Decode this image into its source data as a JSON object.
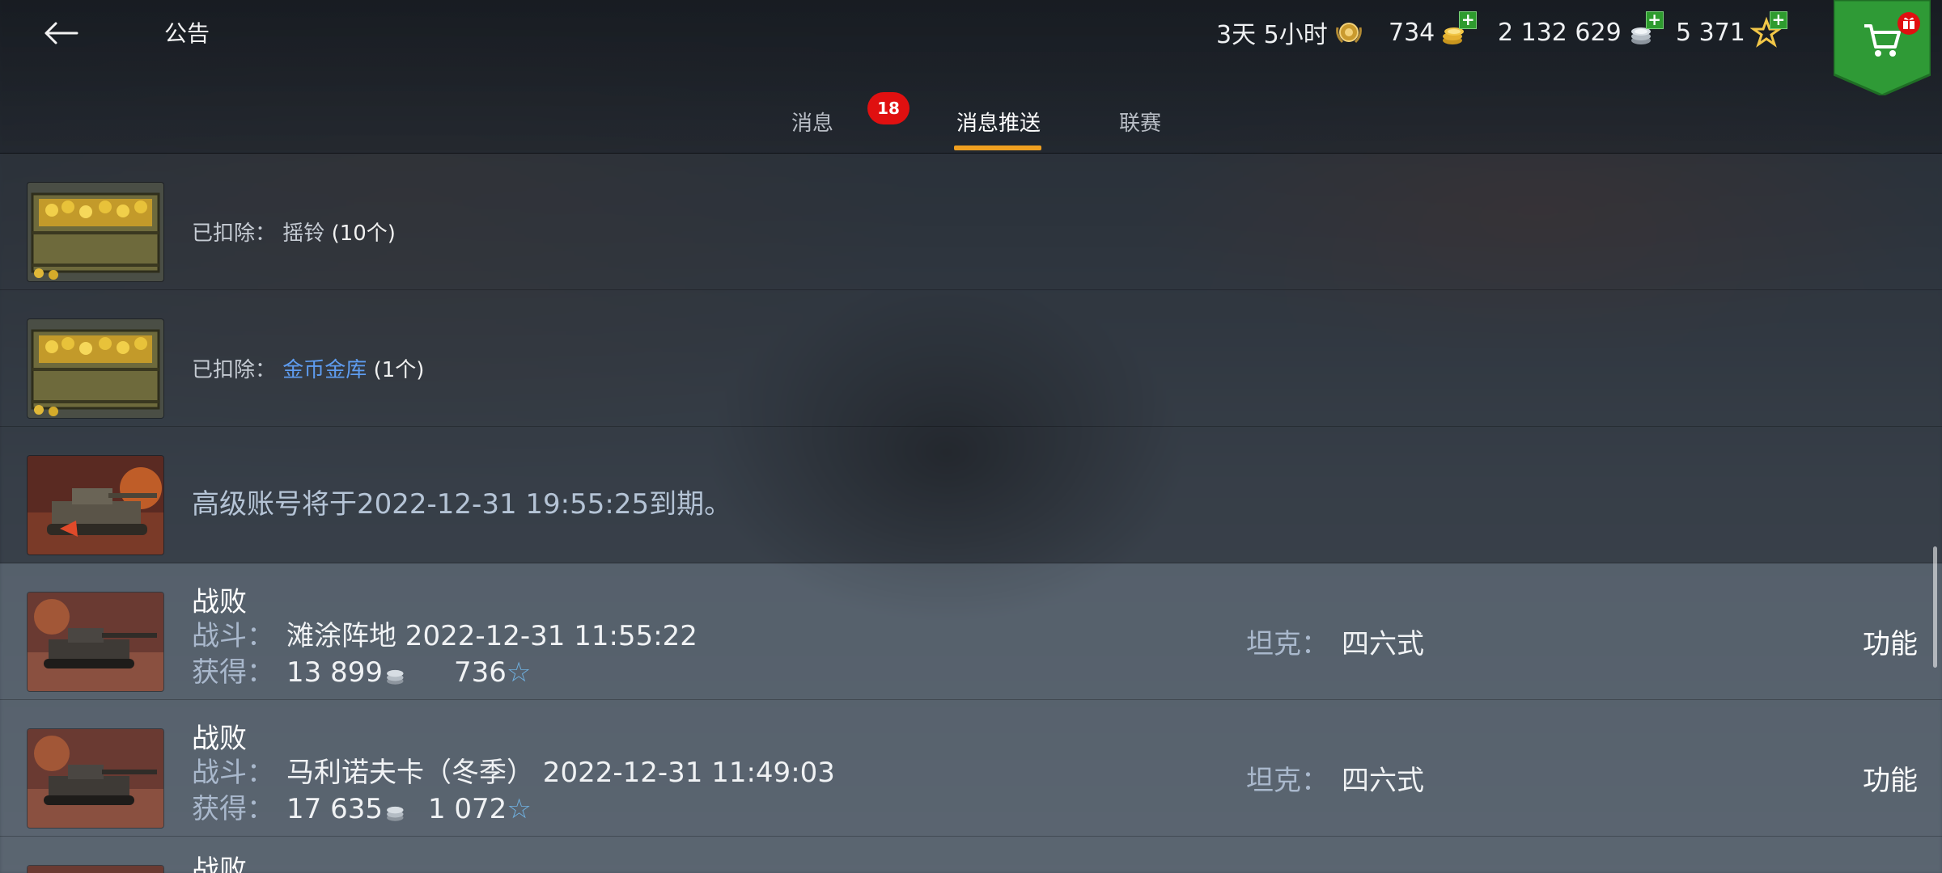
{
  "header": {
    "title": "公告",
    "premium_time": "3天 5小时",
    "gold": "734",
    "credits": "2 132 629",
    "free_xp": "5 371"
  },
  "tabs": [
    {
      "label": "消息",
      "badge": "18"
    },
    {
      "label": "消息推送"
    },
    {
      "label": "联赛"
    }
  ],
  "messages": {
    "row1": {
      "prefix": "已扣除：",
      "item": "摇铃",
      "qty": "(10个)"
    },
    "row2": {
      "prefix": "已扣除：",
      "item": "金币金库",
      "qty": "(1个)"
    },
    "row3": {
      "text_a": "高级账号将于",
      "date": "2022-12-31 19:55:25",
      "text_b": "到期。"
    },
    "battle1": {
      "title": "战败",
      "battle_label": "战斗：",
      "battle_value": "滩涂阵地 2022-12-31 11:55:22",
      "earned_label": "获得：",
      "credits": "13 899",
      "xp": "736",
      "tank_label": "坦克：",
      "tank_value": "四六式",
      "function_label": "功能"
    },
    "battle2": {
      "title": "战败",
      "battle_label": "战斗：",
      "battle_value": "马利诺夫卡（冬季） 2022-12-31 11:49:03",
      "earned_label": "获得：",
      "credits": "17 635",
      "xp": "1 072",
      "tank_label": "坦克：",
      "tank_value": "四六式",
      "function_label": "功能"
    },
    "battle3": {
      "title": "战败"
    }
  },
  "colors": {
    "accent_tab": "#f0a020",
    "badge_red": "#e01010",
    "item_blue": "#5e9cf0",
    "shop_green": "#2f9a36"
  },
  "icons": [
    "back-arrow-icon",
    "premium-medal-icon",
    "gold-coins-icon",
    "silver-credits-icon",
    "free-xp-star-icon",
    "shopping-cart-icon",
    "gift-icon"
  ]
}
